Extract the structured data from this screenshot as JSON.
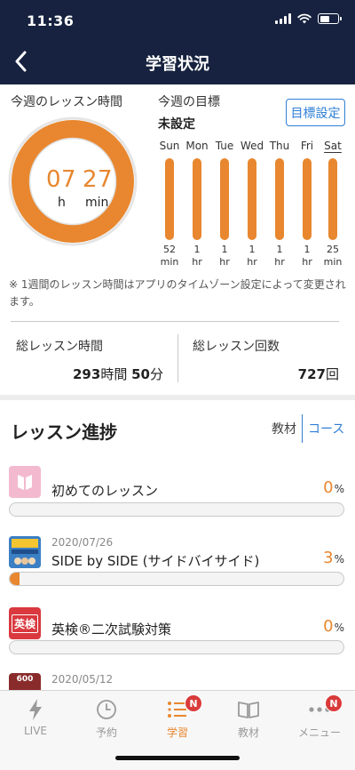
{
  "status_bar": {
    "time": "11:36"
  },
  "header": {
    "title": "学習状況"
  },
  "weekly": {
    "lesson_time_label": "今週のレッスン時間",
    "hours": "07",
    "minutes": "27",
    "hours_unit": "h",
    "minutes_unit": "min",
    "goal_label": "今週の目標",
    "goal_value": "未設定",
    "goal_button": "目標設定",
    "days": [
      {
        "name": "Sun",
        "value": "52",
        "unit": "min"
      },
      {
        "name": "Mon",
        "value": "1",
        "unit": "hr"
      },
      {
        "name": "Tue",
        "value": "1",
        "unit": "hr"
      },
      {
        "name": "Wed",
        "value": "1",
        "unit": "hr"
      },
      {
        "name": "Thu",
        "value": "1",
        "unit": "hr"
      },
      {
        "name": "Fri",
        "value": "1",
        "unit": "hr"
      },
      {
        "name": "Sat",
        "value": "25",
        "unit": "min"
      }
    ],
    "note": "※ 1週間のレッスン時間はアプリのタイムゾーン設定によって変更されます。"
  },
  "totals": {
    "time_label": "総レッスン時間",
    "time_hours": "293",
    "time_hours_unit": "時間",
    "time_minutes": "50",
    "time_minutes_unit": "分",
    "count_label": "総レッスン回数",
    "count_value": "727",
    "count_unit": "回"
  },
  "progress": {
    "title": "レッスン進捗",
    "tab_material": "教材",
    "tab_course": "コース",
    "courses": [
      {
        "date": "",
        "name": "初めてのレッスン",
        "percent": "0",
        "percent_unit": "%",
        "fill": 0
      },
      {
        "date": "2020/07/26",
        "name": "SIDE by SIDE (サイドバイサイド)",
        "percent": "3",
        "percent_unit": "%",
        "fill": 0.03
      },
      {
        "date": "",
        "name": "英検®二次試験対策",
        "percent": "0",
        "percent_unit": "%",
        "fill": 0,
        "icon_text": "英検"
      },
      {
        "date": "2020/05/12",
        "name": "",
        "percent": "",
        "percent_unit": "",
        "fill": 0,
        "icon_text": "600"
      }
    ]
  },
  "tabbar": {
    "items": [
      {
        "label": "LIVE",
        "icon": "bolt-icon"
      },
      {
        "label": "予約",
        "icon": "clock-icon"
      },
      {
        "label": "学習",
        "icon": "study-list-icon",
        "badge": "N"
      },
      {
        "label": "教材",
        "icon": "book-icon"
      },
      {
        "label": "メニュー",
        "icon": "more-icon",
        "badge": "N"
      }
    ]
  },
  "colors": {
    "accent": "#e8872f",
    "header_bg": "#16223f",
    "link": "#2f7fd6",
    "badge": "#d93a3a"
  }
}
